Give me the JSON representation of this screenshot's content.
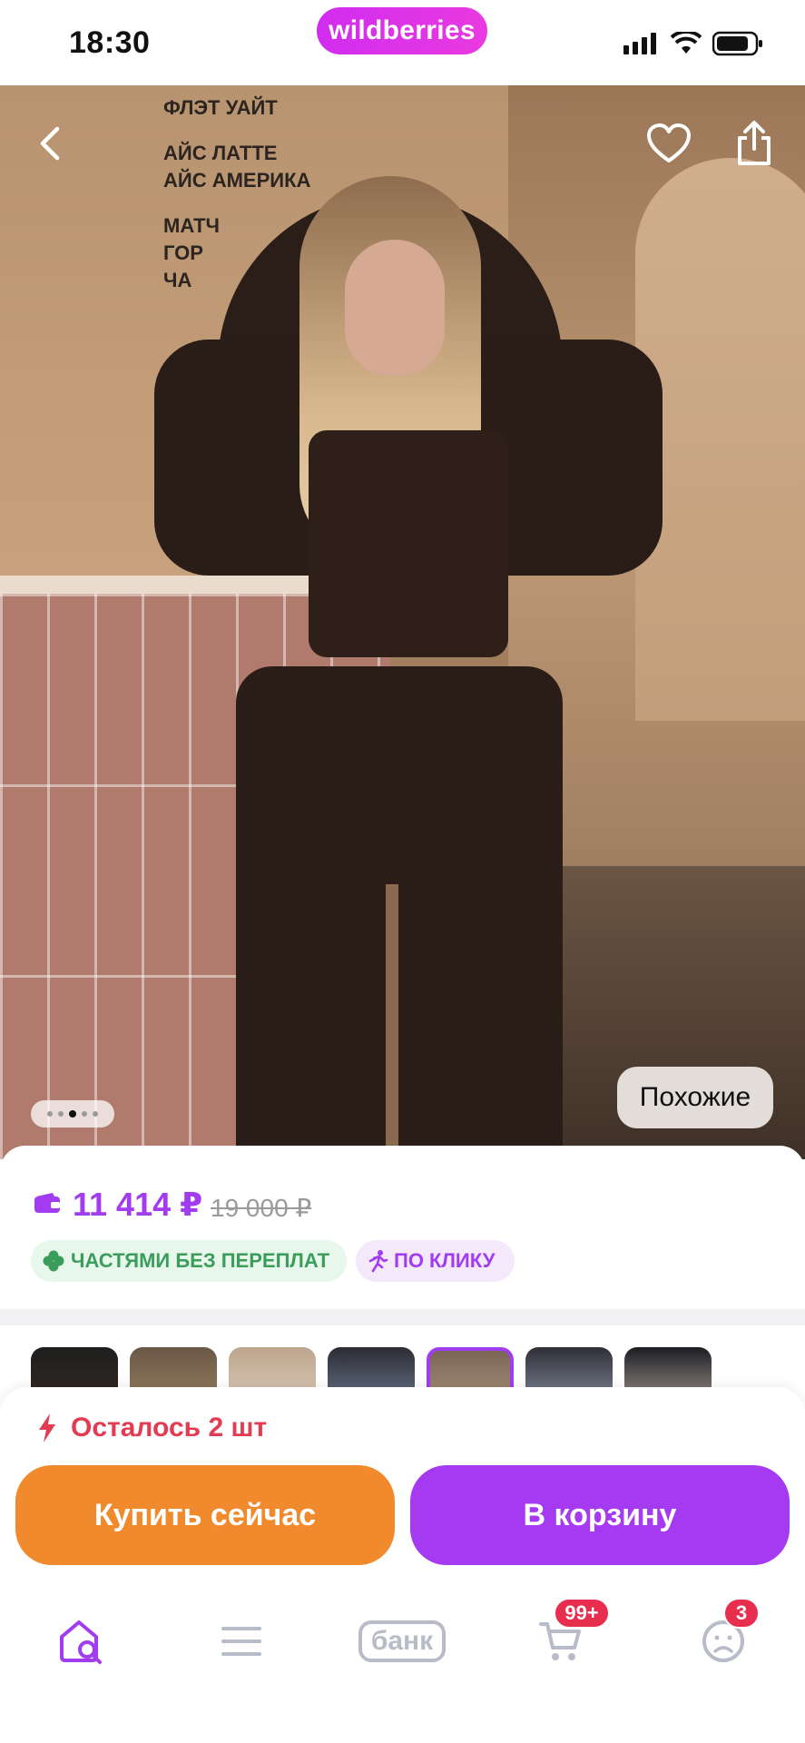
{
  "status_bar": {
    "time": "18:30",
    "brand": "wildberries",
    "icons": [
      "signal-icon",
      "wifi-icon",
      "battery-icon"
    ]
  },
  "photo": {
    "background_menu_lines": [
      "ФЛЭТ УАЙТ",
      "АЙС ЛАТТЕ",
      "АЙС АМЕРИКА",
      "МАТЧ",
      "ГОР",
      "ЧА"
    ],
    "similar_label": "Похожие",
    "pager": {
      "count": 5,
      "active_index": 2
    }
  },
  "price": {
    "current": "11 414 ₽",
    "old": "19 000 ₽",
    "badges": [
      {
        "label": "ЧАСТЯМИ БЕЗ ПЕРЕПЛАТ",
        "icon": "clover-icon"
      },
      {
        "label": "ПО КЛИКУ",
        "icon": "running-person-icon"
      }
    ]
  },
  "thumbnails": {
    "count": 7,
    "selected_index": 4
  },
  "purchase": {
    "stock_text": "Осталось 2 шт",
    "buy_now": "Купить сейчас",
    "add_to_cart": "В корзину"
  },
  "tabbar": {
    "items": [
      {
        "name": "home",
        "icon": "home-search-icon",
        "active": true
      },
      {
        "name": "catalog",
        "icon": "menu-icon"
      },
      {
        "name": "bank",
        "label": "банк"
      },
      {
        "name": "cart",
        "icon": "cart-icon",
        "badge": "99+"
      },
      {
        "name": "profile",
        "icon": "profile-icon",
        "badge": "3"
      }
    ]
  },
  "colors": {
    "accent_purple": "#a23cf0",
    "buy_orange": "#f08a2c",
    "cart_purple": "#a53af0",
    "alert_red": "#e23b52",
    "badge_green": "#3a9e5a"
  }
}
